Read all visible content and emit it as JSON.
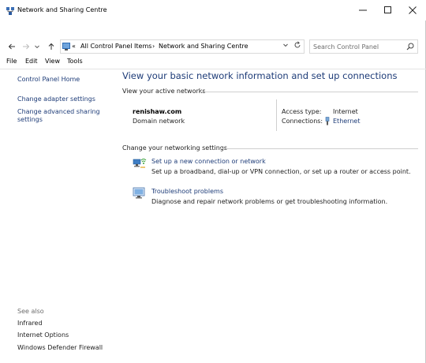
{
  "window": {
    "title": "Network and Sharing Centre",
    "controls": {
      "minimize_icon": "minimize-icon",
      "maximize_icon": "maximize-icon",
      "close_icon": "close-icon"
    }
  },
  "address_bar": {
    "overflow": "«",
    "crumbs": [
      "All Control Panel Items",
      "Network and Sharing Centre"
    ],
    "separator": "›"
  },
  "search": {
    "placeholder": "Search Control Panel"
  },
  "menu": {
    "items": [
      "File",
      "Edit",
      "View",
      "Tools"
    ]
  },
  "sidebar": {
    "links": [
      "Control Panel Home",
      "Change adapter settings",
      "Change advanced sharing",
      "settings"
    ],
    "see_also_label": "See also",
    "see_also": [
      "Infrared",
      "Internet Options",
      "Windows Defender Firewall"
    ]
  },
  "main": {
    "title": "View your basic network information and set up connections",
    "active_networks_label": "View your active networks",
    "network": {
      "name": "renishaw.com",
      "type": "Domain network",
      "access_type_label": "Access type:",
      "access_type_value": "Internet",
      "connections_label": "Connections:",
      "connection_name": "Ethernet"
    },
    "change_settings_label": "Change your networking settings",
    "tasks": [
      {
        "title": "Set up a new connection or network",
        "description": "Set up a broadband, dial-up or VPN connection, or set up a router or access point."
      },
      {
        "title": "Troubleshoot problems",
        "description": "Diagnose and repair network problems or get troubleshooting information."
      }
    ]
  },
  "colors": {
    "link": "#1e3c78",
    "title": "#1e3c78",
    "divider": "#cfcfcf"
  }
}
